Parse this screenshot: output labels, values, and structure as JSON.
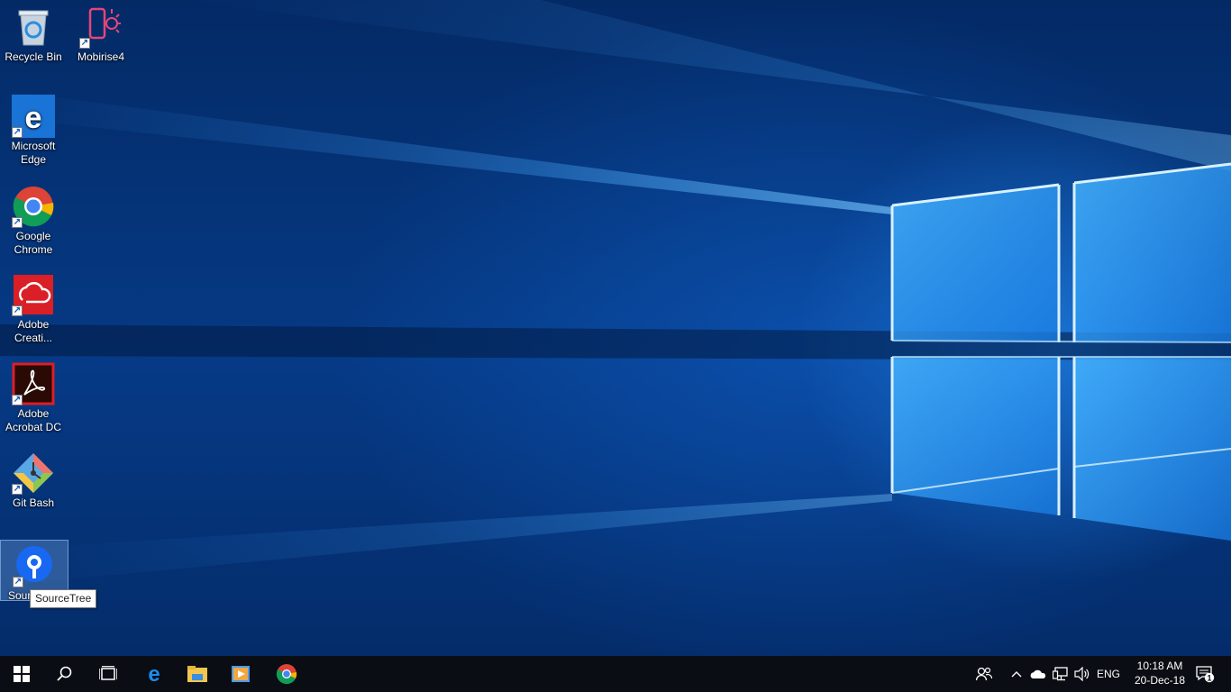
{
  "desktop": {
    "icons": [
      {
        "label": "Recycle Bin",
        "icon": "recycle-bin-icon",
        "shortcut": false
      },
      {
        "label": "Mobirise4",
        "icon": "mobirise-icon",
        "shortcut": true
      },
      {
        "label": "Microsoft Edge",
        "icon": "edge-icon",
        "shortcut": true
      },
      {
        "label": "Google Chrome",
        "icon": "chrome-icon",
        "shortcut": true
      },
      {
        "label": "Adobe Creati...",
        "icon": "creative-cloud-icon",
        "shortcut": true
      },
      {
        "label": "Adobe Acrobat DC",
        "icon": "acrobat-icon",
        "shortcut": true
      },
      {
        "label": "Git Bash",
        "icon": "git-icon",
        "shortcut": true
      },
      {
        "label": "Sour",
        "icon": "sourcetree-icon",
        "shortcut": true,
        "selected": true
      }
    ],
    "tooltip": "SourceTree"
  },
  "taskbar": {
    "start": "windows-logo-icon",
    "search": "search-icon",
    "task_view": "task-view-icon",
    "pinned": [
      {
        "name": "edge-icon"
      },
      {
        "name": "file-explorer-icon"
      },
      {
        "name": "media-player-icon"
      },
      {
        "name": "chrome-icon"
      }
    ],
    "tray": {
      "people": "people-icon",
      "chevron": "chevron-up-icon",
      "onedrive": "onedrive-icon",
      "network": "network-icon",
      "volume": "volume-icon",
      "language": "ENG",
      "time": "10:18 AM",
      "date": "20-Dec-18",
      "notifications_count": "1"
    }
  },
  "colors": {
    "wallpaper_dark": "#042a66",
    "wallpaper_glow": "#2896ff",
    "taskbar": "#0a0d13"
  }
}
